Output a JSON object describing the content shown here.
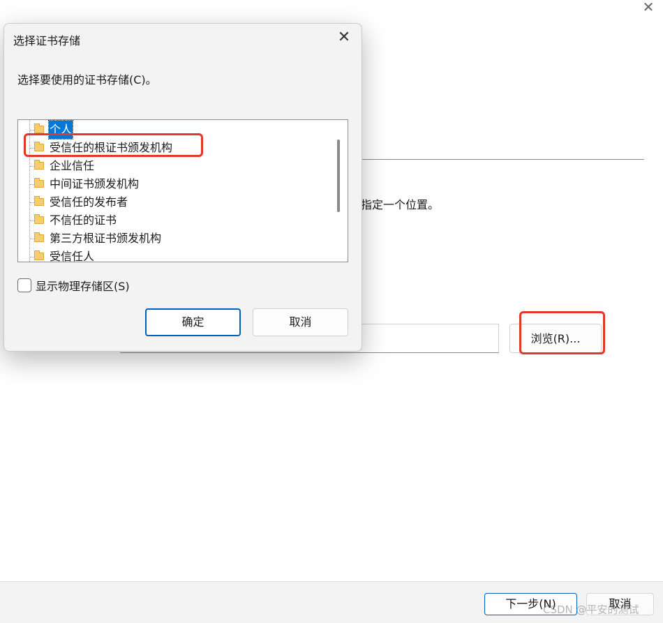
{
  "background_wizard": {
    "close_glyph": "✕",
    "instruction_text": "指定一个位置。",
    "path_value": "",
    "browse_label": "浏览(R)...",
    "next_label": "下一步(N)",
    "cancel_label": "取消",
    "watermark": "CSDN @平安的测试"
  },
  "dialog": {
    "title": "选择证书存储",
    "close_glyph": "✕",
    "prompt": "选择要使用的证书存储(C)。",
    "tree_items": [
      {
        "label": "个人",
        "selected": true,
        "icon": "folder-icon"
      },
      {
        "label": "受信任的根证书颁发机构",
        "selected": false,
        "icon": "folder-icon"
      },
      {
        "label": "企业信任",
        "selected": false,
        "icon": "folder-icon"
      },
      {
        "label": "中间证书颁发机构",
        "selected": false,
        "icon": "folder-icon"
      },
      {
        "label": "受信任的发布者",
        "selected": false,
        "icon": "folder-icon"
      },
      {
        "label": "不信任的证书",
        "selected": false,
        "icon": "folder-icon"
      },
      {
        "label": "第三方根证书颁发机构",
        "selected": false,
        "icon": "folder-icon"
      },
      {
        "label": "受信任人",
        "selected": false,
        "icon": "folder-icon"
      }
    ],
    "show_physical_label": "显示物理存储区(S)",
    "show_physical_checked": false,
    "ok_label": "确定",
    "cancel_label": "取消"
  },
  "colors": {
    "selection": "#0078d7",
    "highlight_annotation": "#e0382b",
    "accent_border": "#005fb8"
  }
}
